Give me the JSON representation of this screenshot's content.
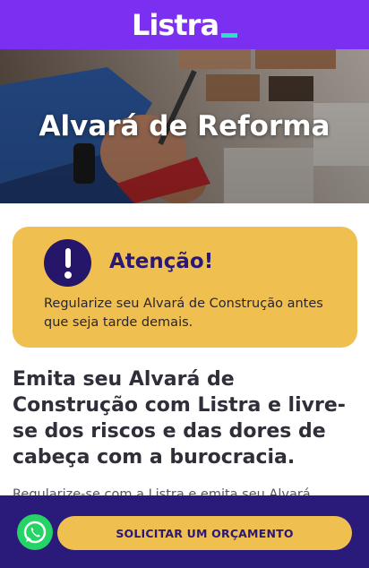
{
  "header": {
    "logo_text": "Listra",
    "brand_color": "#7b2ff0",
    "logo_accent_color": "#2fe0c8"
  },
  "hero": {
    "title": "Alvará de Reforma",
    "image": "worker-drilling-wall"
  },
  "alert": {
    "icon": "exclamation-icon",
    "title": "Atenção!",
    "text": "Regularize seu Alvará de Construção antes que seja tarde demais.",
    "background_color": "#efc04f"
  },
  "main": {
    "headline": "Emita seu Alvará de Construção com Listra e livre-se dos riscos e das dores de cabeça com a burocracia.",
    "body_text": "Regularize-se com a Listra e emita seu Alvará"
  },
  "bottom_bar": {
    "whatsapp_icon": "whatsapp-icon",
    "cta_label": "SOLICITAR UM ORÇAMENTO",
    "background_color": "#2a1b7a"
  }
}
